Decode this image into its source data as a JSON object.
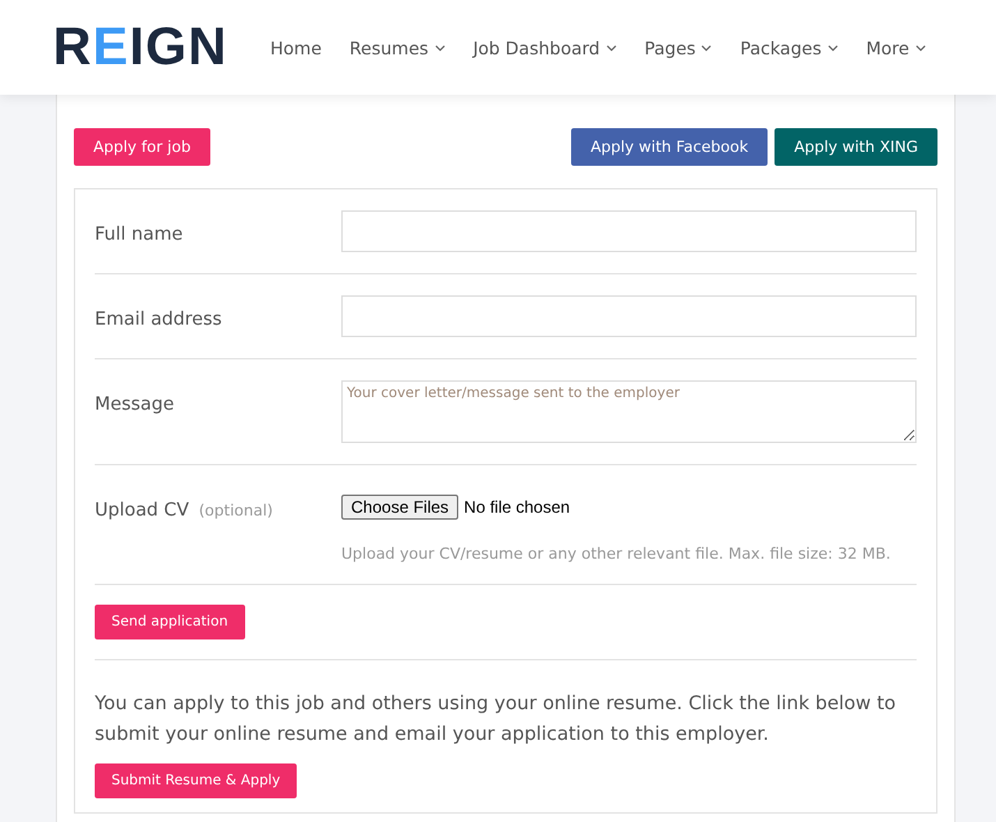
{
  "logo": "REIGN",
  "nav": [
    {
      "label": "Home",
      "dropdown": false
    },
    {
      "label": "Resumes",
      "dropdown": true
    },
    {
      "label": "Job Dashboard",
      "dropdown": true
    },
    {
      "label": "Pages",
      "dropdown": true
    },
    {
      "label": "Packages",
      "dropdown": true
    },
    {
      "label": "More",
      "dropdown": true
    }
  ],
  "apply_button": "Apply for job",
  "social_buttons": [
    {
      "label": "Apply with Facebook",
      "color": "#4462ab"
    },
    {
      "label": "Apply with XING",
      "color": "#026466"
    }
  ],
  "fields": [
    {
      "kind": "text",
      "label": "Full name"
    },
    {
      "kind": "text",
      "label": "Email address"
    },
    {
      "kind": "textarea",
      "label": "Message",
      "placeholder": "Your cover letter/message sent to the employer"
    },
    {
      "kind": "file",
      "label": "Upload CV",
      "note": "(optional)",
      "button": "Choose Files",
      "status": "No file chosen",
      "help": "Upload your CV/resume or any other relevant file. Max. file size: 32 MB."
    }
  ],
  "send_button": "Send application",
  "resume_text": "You can apply to this job and others using your online resume. Click the link below to submit your online resume and email your application to this employer.",
  "submit_button": "Submit Resume & Apply"
}
